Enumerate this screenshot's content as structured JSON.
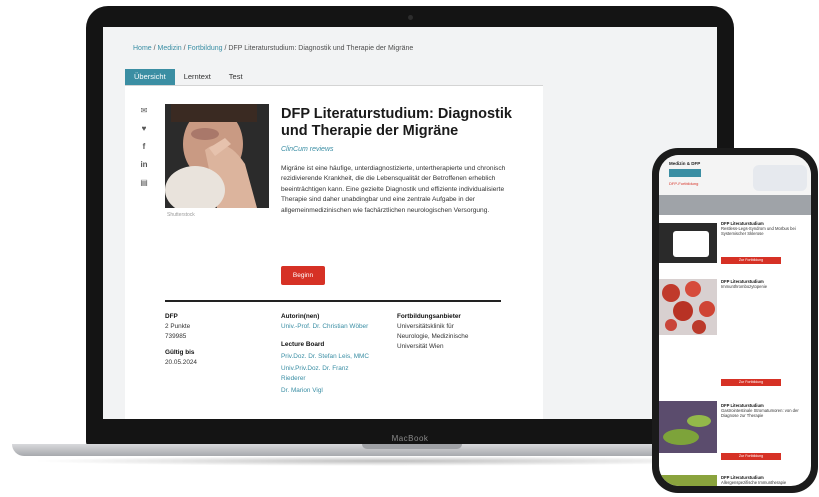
{
  "laptop": {
    "brand": "MacBook",
    "breadcrumb": {
      "home": "Home",
      "sep1": " / ",
      "medizin": "Medizin",
      "sep2": " / ",
      "fortbildung": "Fortbildung",
      "sep3": " / ",
      "current": "DFP Literaturstudium: Diagnostik und Therapie der Migräne"
    },
    "tabs": [
      {
        "label": "Übersicht",
        "active": true
      },
      {
        "label": "Lerntext",
        "active": false
      },
      {
        "label": "Test",
        "active": false
      }
    ],
    "share_icons": [
      "mail-icon",
      "twitter-icon",
      "facebook-icon",
      "linkedin-icon",
      "print-icon"
    ],
    "article": {
      "title": "DFP Literaturstudium: Diagnostik und Therapie der Migräne",
      "subtitle": "ClinCum reviews",
      "description": "Migräne ist eine häufige, unterdiagnostizierte, untertherapierte und chronisch rezidivierende Krankheit, die die Lebensqualität der Betroffenen erheblich beeinträchtigen kann. Eine gezielte Diagnostik und effiziente individualisierte Therapie sind daher unabdingbar und eine zentrale Aufgabe in der allgemeinmedizinischen wie fachärztlichen neurologischen Versorgung.",
      "photo_caption": "Shutterstock",
      "start_button": "Beginn"
    },
    "meta": {
      "dfp_heading": "DFP",
      "dfp_points": "2 Punkte",
      "dfp_id": "739985",
      "valid_heading": "Gültig bis",
      "valid_date": "20.05.2024",
      "author_heading": "Autorin(nen)",
      "author_name": "Univ.-Prof. Dr. Christian Wöber",
      "board_heading": "Lecture Board",
      "board": [
        "Priv.Doz. Dr. Stefan Leis, MMC",
        "Univ.Priv.Doz. Dr. Franz",
        "Riederer",
        "Dr. Marion Vigl"
      ],
      "provider_heading": "Fortbildungsanbieter",
      "provider_lines": [
        "Universitätsklinik für",
        "Neurologie, Medizinische",
        "Universität Wien"
      ]
    }
  },
  "phone": {
    "header_title": "Medizin & DFP",
    "header_sub": "DFP-Fortbildung",
    "cards": [
      {
        "heading": "DFP Literaturstudium",
        "title": "Restless-Legs-Syndrom und Morbus bei Systemischer Sklerose",
        "button": "Zur Fortbildung"
      },
      {
        "heading": "DFP Literaturstudium",
        "title": "Immunthrombozytopenie",
        "button": "Zur Fortbildung"
      },
      {
        "heading": "DFP Literaturstudium",
        "title": "Gastrointestinale Stromatumoren: von der Diagnose zur Therapie",
        "button": "Zur Fortbildung"
      },
      {
        "heading": "DFP Literaturstudium",
        "title": "Allergenspezifische Immuntherapie",
        "button": ""
      }
    ]
  },
  "colors": {
    "accent_teal": "#3b8ea3",
    "accent_red": "#d63125"
  }
}
